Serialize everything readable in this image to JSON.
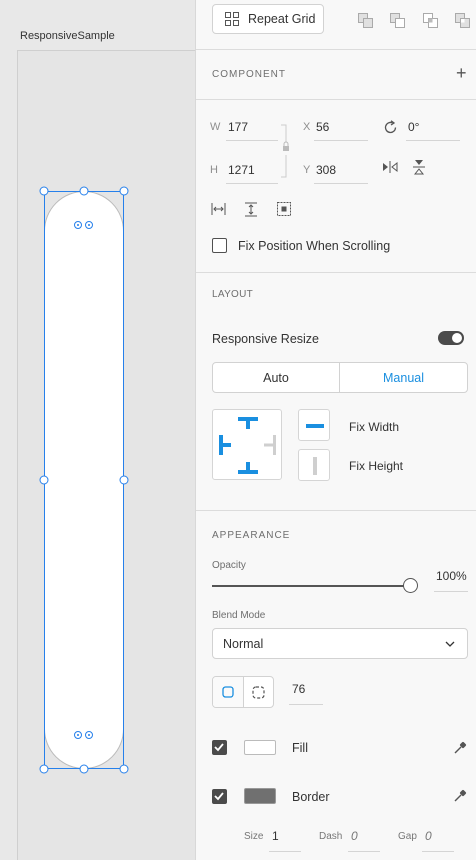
{
  "canvas": {
    "artboard_name": "ResponsiveSample"
  },
  "toolbar": {
    "repeat_grid_label": "Repeat Grid",
    "icons": [
      "add-icon",
      "subtract-icon",
      "intersect-icon",
      "exclude-icon"
    ]
  },
  "component": {
    "title": "COMPONENT",
    "add_symbol": "+"
  },
  "transform": {
    "w_label": "W",
    "w_value": "177",
    "h_label": "H",
    "h_value": "1271",
    "x_label": "X",
    "x_value": "56",
    "y_label": "Y",
    "y_value": "308",
    "rotation_value": "0°",
    "fix_position_label": "Fix Position When Scrolling",
    "fix_position_checked": false
  },
  "layout": {
    "title": "LAYOUT",
    "responsive_resize_label": "Responsive Resize",
    "responsive_resize_on": true,
    "segment_auto": "Auto",
    "segment_manual": "Manual",
    "segment_selected": "Manual",
    "fix_width_label": "Fix Width",
    "fix_height_label": "Fix Height"
  },
  "appearance": {
    "title": "APPEARANCE",
    "opacity_label": "Opacity",
    "opacity_value": "100%",
    "opacity_level": 1.0,
    "blend_mode_label": "Blend Mode",
    "blend_mode_value": "Normal",
    "corner_radius_value": "76",
    "fill_label": "Fill",
    "fill_checked": true,
    "fill_color": "#ffffff",
    "border_label": "Border",
    "border_checked": true,
    "border_color": "#707070",
    "size_label": "Size",
    "size_value": "1",
    "dash_label": "Dash",
    "dash_value": "0",
    "gap_label": "Gap",
    "gap_value": "0"
  },
  "colors": {
    "accent": "#2680eb",
    "layout_blue": "#1a8fe0"
  }
}
